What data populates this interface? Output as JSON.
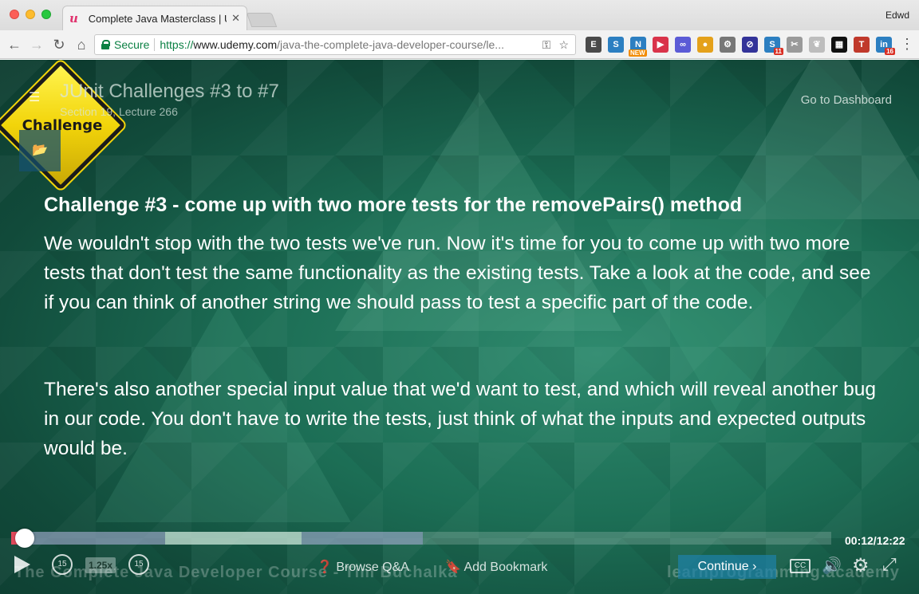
{
  "browser": {
    "tab_title": "Complete Java Masterclass | U",
    "tab_close": "✕",
    "tab_favicon": "u",
    "profile": "Edwd",
    "secure_label": "Secure",
    "url_scheme": "https://",
    "url_host": "www.udemy.com",
    "url_path": "/java-the-complete-java-developer-course/le...",
    "nav": {
      "back": "←",
      "forward": "→",
      "reload": "↻",
      "home": "⌂"
    },
    "omni_icons": [
      "key-icon",
      "star-icon"
    ],
    "extensions": [
      {
        "name": "evernote-extension-icon",
        "color": "#4a4a4a",
        "glyph": "E"
      },
      {
        "name": "screenshot-extension-icon",
        "color": "#2c7fc1",
        "glyph": "S"
      },
      {
        "name": "news-extension-icon",
        "color": "#2c7fc1",
        "glyph": "N",
        "badge": "NEW"
      },
      {
        "name": "pocket-extension-icon",
        "color": "#d9334a",
        "glyph": "▶"
      },
      {
        "name": "sync-extension-icon",
        "color": "#5b5bd6",
        "glyph": "∞"
      },
      {
        "name": "chrome-extension-icon",
        "color": "#e4a11b",
        "glyph": "●"
      },
      {
        "name": "settings-extension-icon",
        "color": "#777777",
        "glyph": "⚙"
      },
      {
        "name": "block-extension-icon",
        "color": "#333399",
        "glyph": "⊘"
      },
      {
        "name": "calendar-extension-icon",
        "color": "#2c7fc1",
        "glyph": "S",
        "badge": "11"
      },
      {
        "name": "scissors-extension-icon",
        "color": "#9a9a9a",
        "glyph": "✂"
      },
      {
        "name": "feather-extension-icon",
        "color": "#bdbdbd",
        "glyph": "❦"
      },
      {
        "name": "grid-extension-icon",
        "color": "#111111",
        "glyph": "▦"
      },
      {
        "name": "trello-extension-icon",
        "color": "#c0392b",
        "glyph": "T"
      },
      {
        "name": "linkedin-extension-icon",
        "color": "#2c7fc1",
        "glyph": "in",
        "badge": "16"
      }
    ],
    "menu": "⋮"
  },
  "player": {
    "lecture_title": "JUnit Challenges #3 to #7",
    "lecture_subtitle": "Section 19, Lecture 266",
    "dashboard_label": "Go to Dashboard",
    "sign_text": "Challenge",
    "heading": "Challenge #3 - come up with two more tests for the removePairs() method",
    "paragraph_1": "We wouldn't stop with the two tests we've run. Now it's time for you to come up with two more tests that don't test the same functionality as the existing tests. Take a look at the code, and see if you can think of another string we should pass to test a specific part of the code.",
    "paragraph_2": "There's also another special input value that we'd want to test, and which will reveal another bug in our code. You don't have to write the tests, just think of what the inputs and expected outputs would be.",
    "time": "00:12/12:22",
    "progress_fraction": 0.016,
    "skip_back": "15",
    "skip_forward": "15",
    "speed": "1.25x",
    "browse_qa": "Browse Q&A",
    "add_bookmark": "Add Bookmark",
    "continue_label": "Continue",
    "watermark_left": "The Complete Java Developer Course - Tim Buchalka",
    "watermark_right": "learnprogramming.academy",
    "accent_color": "#e0485a"
  }
}
